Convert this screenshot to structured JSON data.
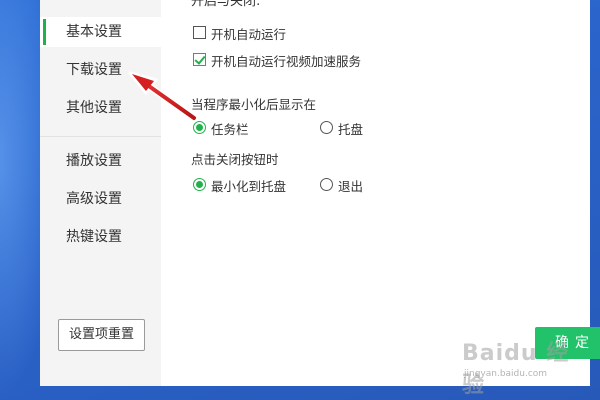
{
  "sidebar": {
    "items": [
      {
        "label": "基本设置",
        "active": true
      },
      {
        "label": "下载设置",
        "active": false
      },
      {
        "label": "其他设置",
        "active": false
      },
      {
        "label": "播放设置",
        "active": false
      },
      {
        "label": "高级设置",
        "active": false
      },
      {
        "label": "热键设置",
        "active": false
      }
    ],
    "reset_label": "设置项重置"
  },
  "content": {
    "cut_title": "开启与关闭:",
    "startup": {
      "autostart_label": "开机自动运行",
      "autostart_checked": false,
      "autostart_accel_label": "开机自动运行视频加速服务",
      "autostart_accel_checked": true
    },
    "minimize_section": {
      "title": "当程序最小化后显示在",
      "options": [
        {
          "label": "任务栏",
          "selected": true
        },
        {
          "label": "托盘",
          "selected": false
        }
      ]
    },
    "close_section": {
      "title": "点击关闭按钮时",
      "options": [
        {
          "label": "最小化到托盘",
          "selected": true
        },
        {
          "label": "退出",
          "selected": false
        }
      ]
    },
    "ok_label": "确定"
  },
  "watermark": {
    "brand": "Baidu 经验",
    "url": "jingyan.baidu.com"
  },
  "colors": {
    "accent": "#21b14b",
    "ok_button": "#21c26a",
    "desktop": "#2f6fd6",
    "annotation_arrow": "#d42020"
  }
}
